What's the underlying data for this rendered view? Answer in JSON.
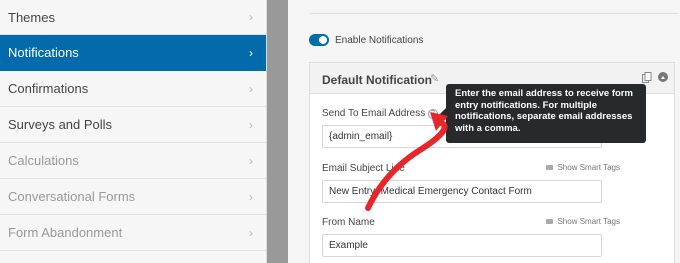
{
  "sidebar": {
    "items": [
      {
        "label": "Themes",
        "state": "normal"
      },
      {
        "label": "Notifications",
        "state": "active"
      },
      {
        "label": "Confirmations",
        "state": "normal"
      },
      {
        "label": "Surveys and Polls",
        "state": "normal"
      },
      {
        "label": "Calculations",
        "state": "muted"
      },
      {
        "label": "Conversational Forms",
        "state": "muted"
      },
      {
        "label": "Form Abandonment",
        "state": "muted"
      }
    ]
  },
  "main": {
    "enable_label": "Enable Notifications",
    "panel": {
      "title": "Default Notification",
      "send_to_label": "Send To Email Address",
      "send_to_value": "{admin_email}",
      "subject_label": "Email Subject Line",
      "subject_value": "New Entry: Medical Emergency Contact Form",
      "from_name_label": "From Name",
      "from_name_value": "Example",
      "smart_tags_label": "Show Smart Tags",
      "help_glyph": "?"
    },
    "tooltip": "Enter the email address to receive form entry notifications. For multiple notifications, separate email addresses with a comma."
  },
  "icons": {
    "chevron": "chevron-right-icon",
    "pencil": "pencil-icon",
    "duplicate": "duplicate-icon",
    "collapse": "collapse-icon",
    "help": "help-icon",
    "tag": "tag-icon"
  },
  "colors": {
    "accent": "#036aab",
    "tooltip_bg": "#272a2c",
    "annotation": "#e5262b"
  }
}
